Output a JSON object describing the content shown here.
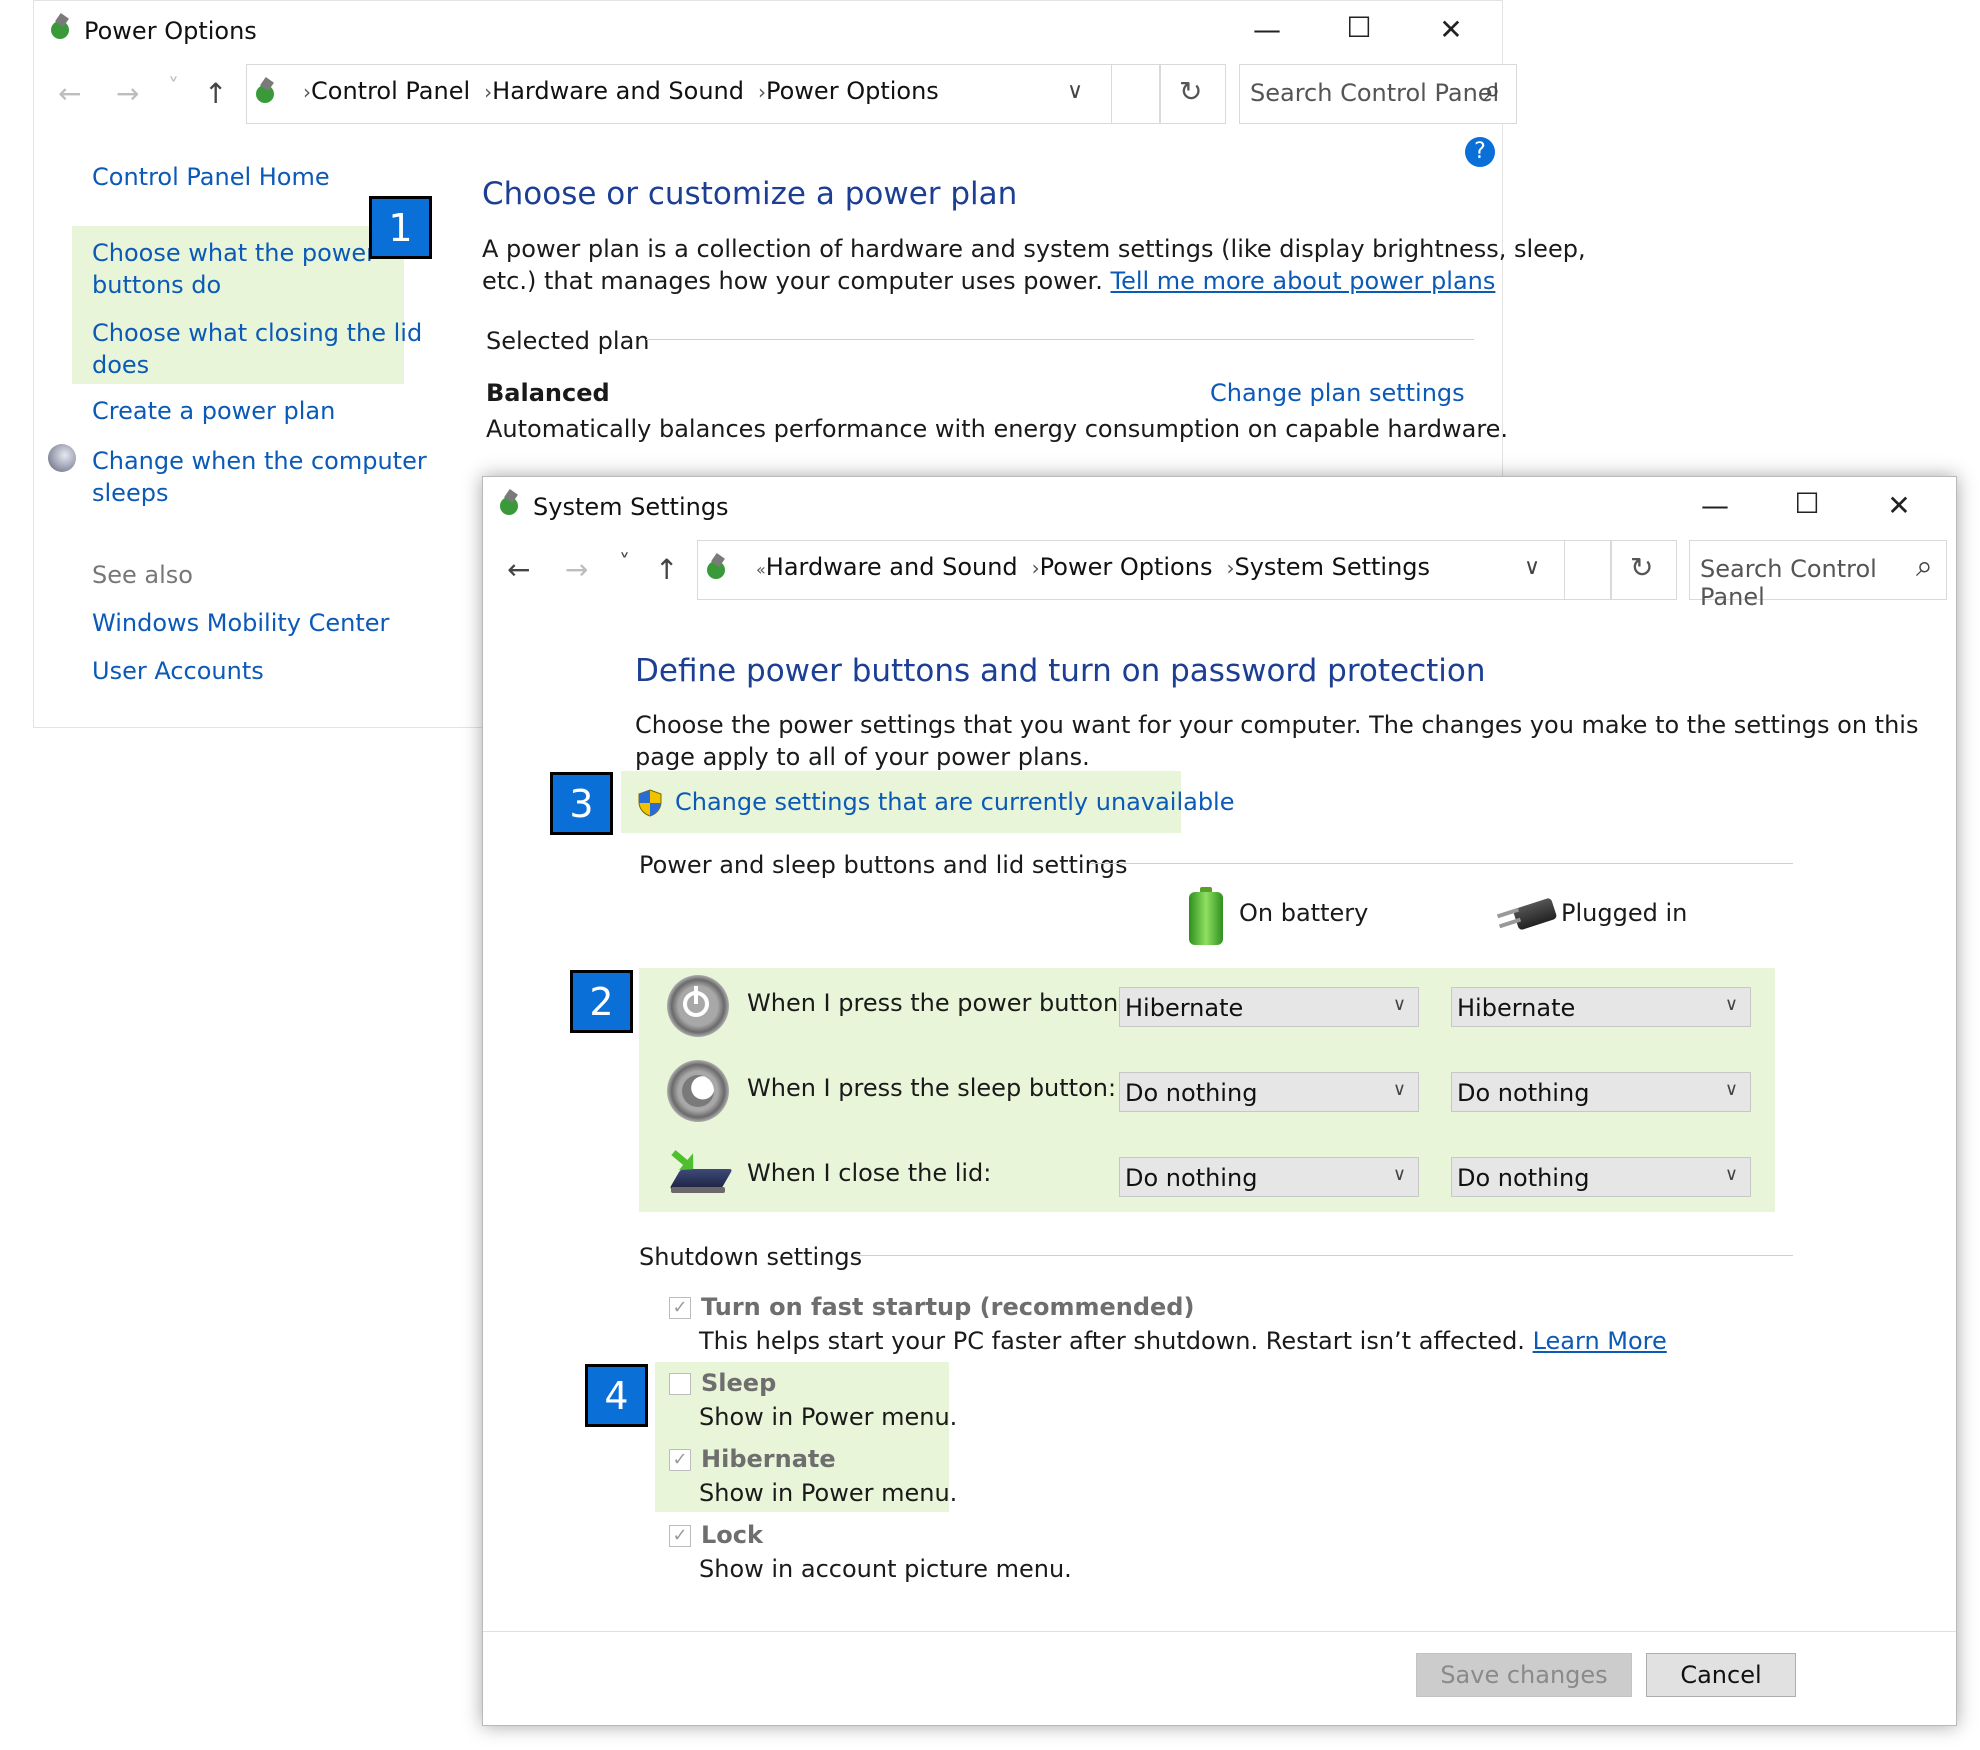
{
  "power_options_window": {
    "title": "Power Options",
    "breadcrumb": [
      "Control Panel",
      "Hardware and Sound",
      "Power Options"
    ],
    "search_placeholder": "Search Control Panel",
    "sidebar": {
      "home": "Control Panel Home",
      "items": [
        {
          "label_line1": "Choose what the power",
          "label_line2": "buttons do"
        },
        {
          "label_line1": "Choose what closing the lid",
          "label_line2": "does"
        },
        {
          "label_line1": "Create a power plan",
          "label_line2": ""
        },
        {
          "label_line1": "Change when the computer",
          "label_line2": "sleeps"
        }
      ],
      "see_also": "See also",
      "see_also_items": [
        "Windows Mobility Center",
        "User Accounts"
      ]
    },
    "main": {
      "heading": "Choose or customize a power plan",
      "description_line1": "A power plan is a collection of hardware and system settings (like display brightness, sleep,",
      "description_line2": "etc.) that manages how your computer uses power.",
      "learn_link": "Tell me more about power plans",
      "selected_plan_label": "Selected plan",
      "plan_name": "Balanced",
      "change_plan_link": "Change plan settings",
      "plan_description": "Automatically balances performance with energy consumption on capable hardware."
    }
  },
  "system_settings_window": {
    "title": "System Settings",
    "breadcrumb_prefix": "«",
    "breadcrumb": [
      "Hardware and Sound",
      "Power Options",
      "System Settings"
    ],
    "search_placeholder": "Search Control Panel",
    "heading": "Define power buttons and turn on password protection",
    "description_line1": "Choose the power settings that you want for your computer. The changes you make to the settings on this",
    "description_line2": "page apply to all of your power plans.",
    "change_settings_link": "Change settings that are currently unavailable",
    "buttons_section_label": "Power and sleep buttons and lid settings",
    "col_battery": "On battery",
    "col_plugged": "Plugged in",
    "rows": [
      {
        "label": "When I press the power button:",
        "battery": "Hibernate",
        "plugged": "Hibernate"
      },
      {
        "label": "When I press the sleep button:",
        "battery": "Do nothing",
        "plugged": "Do nothing"
      },
      {
        "label": "When I close the lid:",
        "battery": "Do nothing",
        "plugged": "Do nothing"
      }
    ],
    "shutdown_section_label": "Shutdown settings",
    "shutdown_options": [
      {
        "title": "Turn on fast startup (recommended)",
        "desc": "This helps start your PC faster after shutdown. Restart isn’t affected.",
        "link": "Learn More",
        "checked": true
      },
      {
        "title": "Sleep",
        "desc": "Show in Power menu.",
        "link": "",
        "checked": false
      },
      {
        "title": "Hibernate",
        "desc": "Show in Power menu.",
        "link": "",
        "checked": true
      },
      {
        "title": "Lock",
        "desc": "Show in account picture menu.",
        "link": "",
        "checked": true
      }
    ],
    "save_button": "Save changes",
    "cancel_button": "Cancel"
  },
  "markers": [
    "1",
    "2",
    "3",
    "4"
  ],
  "colors": {
    "highlight": "#e9f5d8",
    "marker": "#0a6fd6",
    "link": "#0b5ab7",
    "heading": "#1c3f94"
  },
  "glyphs": {
    "back": "←",
    "forward": "→",
    "recent": "˅",
    "up": "↑",
    "chevron": "›",
    "dropdown": "∨",
    "refresh": "↻",
    "search": "⌕",
    "minimize": "—",
    "maximize": "☐",
    "close": "✕",
    "help": "?",
    "check": "✓"
  }
}
